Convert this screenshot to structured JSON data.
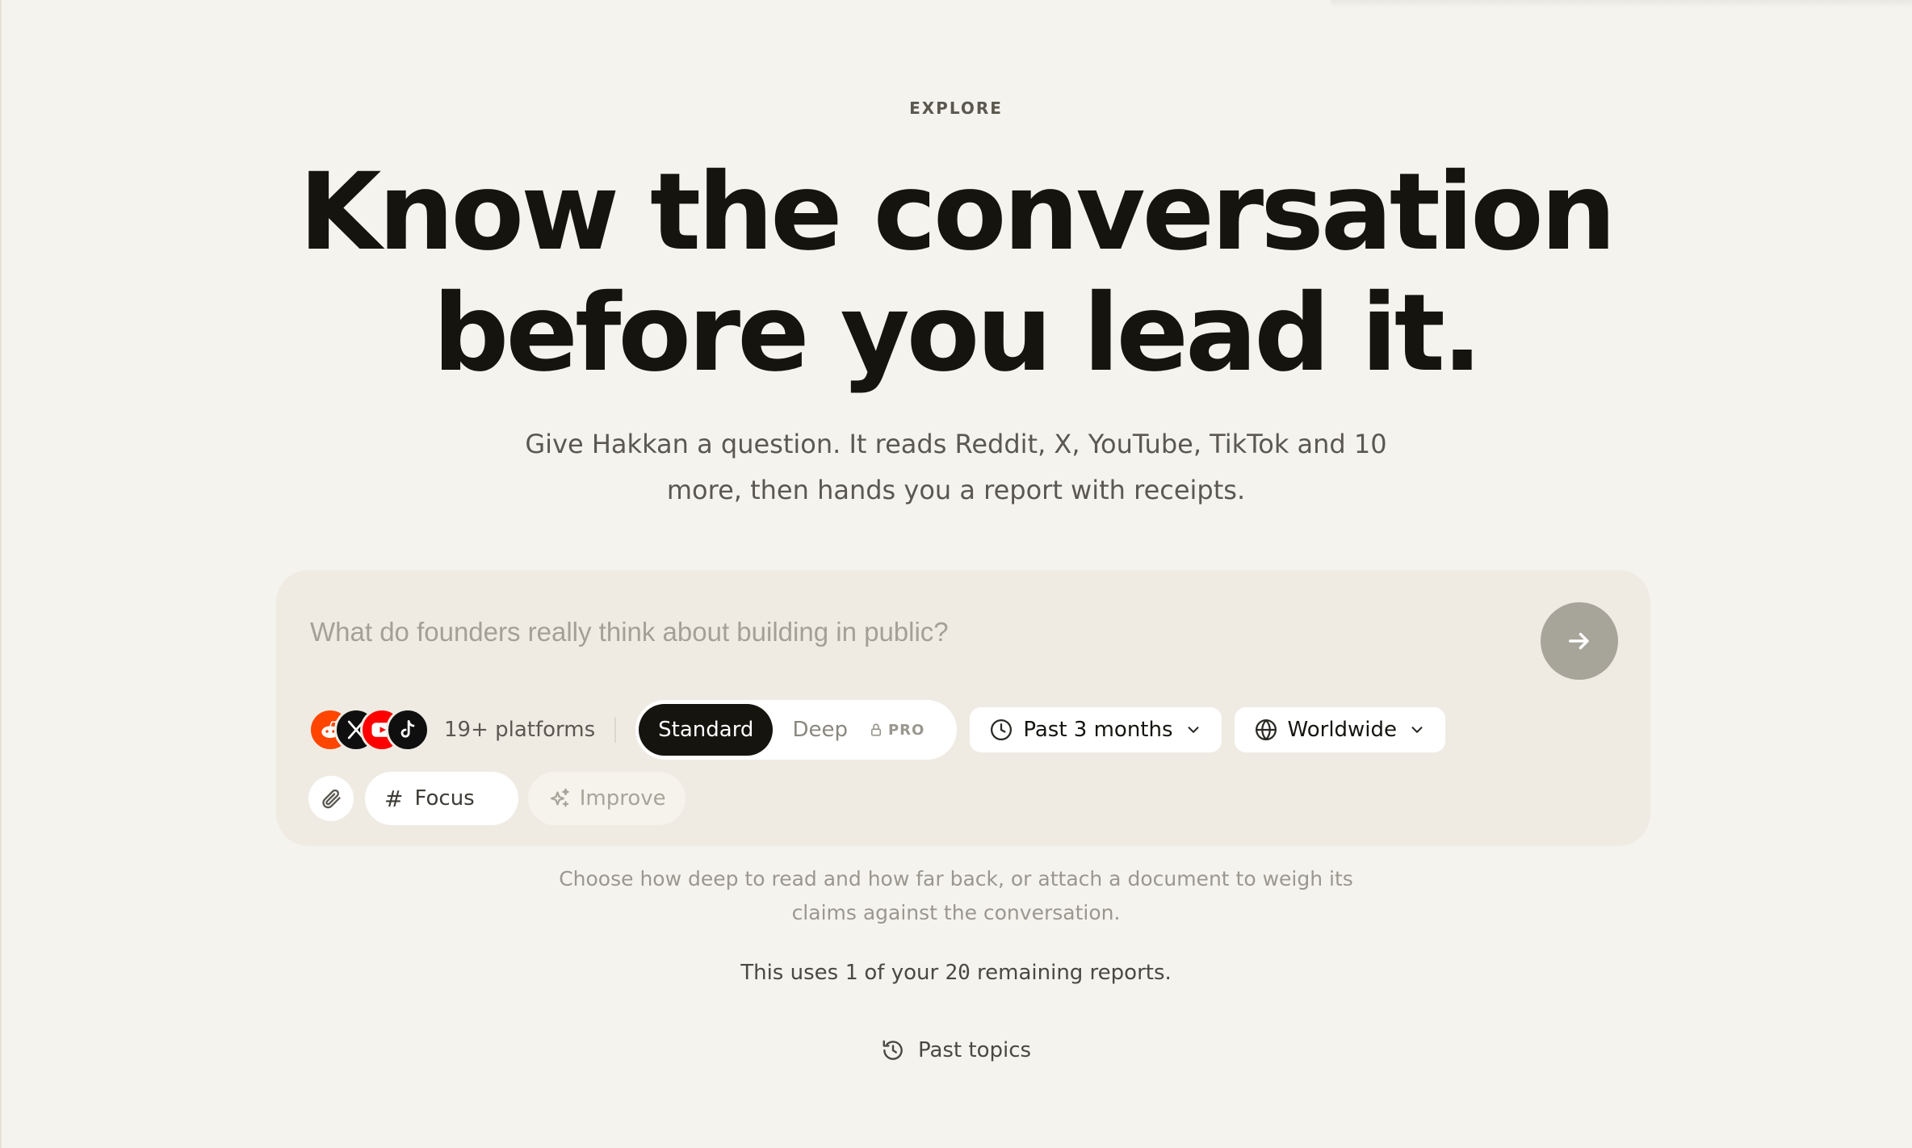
{
  "hero": {
    "eyebrow": "EXPLORE",
    "headline_line1": "Know the conversation",
    "headline_line2": "before you lead it.",
    "subtitle_line1": "Give Hakkan a question. It reads Reddit, X, YouTube, TikTok and 10",
    "subtitle_line2": "more, then hands you a report with receipts."
  },
  "composer": {
    "placeholder": "What do founders really think about building in public?",
    "value": "",
    "platforms": {
      "icons": [
        "reddit-icon",
        "x-icon",
        "youtube-icon",
        "tiktok-icon"
      ],
      "count_label": "19+ platforms"
    },
    "modes": {
      "standard_label": "Standard",
      "deep_label": "Deep",
      "pro_label": "PRO",
      "selected": "Standard"
    },
    "time_range": {
      "label": "Past 3 months",
      "icon": "clock-icon"
    },
    "region": {
      "label": "Worldwide",
      "icon": "globe-icon"
    },
    "attach_icon": "paperclip-icon",
    "focus_label": "Focus",
    "focus_symbol": "#",
    "improve_label": "Improve",
    "send_icon": "arrow-right-icon"
  },
  "helper": {
    "line1": "Choose how deep to read and how far back, or attach a document to weigh its",
    "line2": "claims against the conversation."
  },
  "usage": {
    "prefix": "This uses ",
    "used": "1",
    "middle": " of your ",
    "remaining": "20",
    "suffix": " remaining reports."
  },
  "past_topics": {
    "label": "Past topics",
    "icon": "history-icon"
  },
  "colors": {
    "background": "#f5f3ee",
    "composer_bg": "#efebe3",
    "primary_text": "#15140f",
    "send_button": "#a7a49a",
    "reddit": "#ff4500",
    "youtube": "#ff0000"
  }
}
